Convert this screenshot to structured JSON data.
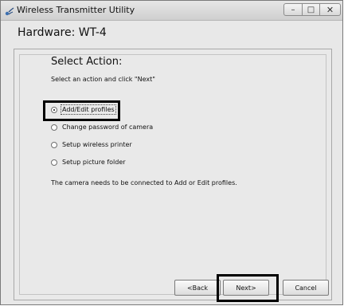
{
  "window": {
    "title": "Wireless Transmitter Utility",
    "icon": "wireless-transmitter-app-icon",
    "controls": {
      "minimize": "–",
      "maximize": "□",
      "close": "✕"
    }
  },
  "hardware_title": "Hardware: WT-4",
  "action": {
    "heading": "Select Action:",
    "instruction": "Select an action and click \"Next\"",
    "selected": "Add/Edit profiles",
    "options": [
      "Add/Edit profiles",
      "Change password of camera",
      "Setup wireless printer",
      "Setup picture folder"
    ],
    "note": "The camera needs to be connected to Add or Edit profiles."
  },
  "buttons": {
    "back": "<Back",
    "next": "Next>",
    "cancel": "Cancel"
  }
}
